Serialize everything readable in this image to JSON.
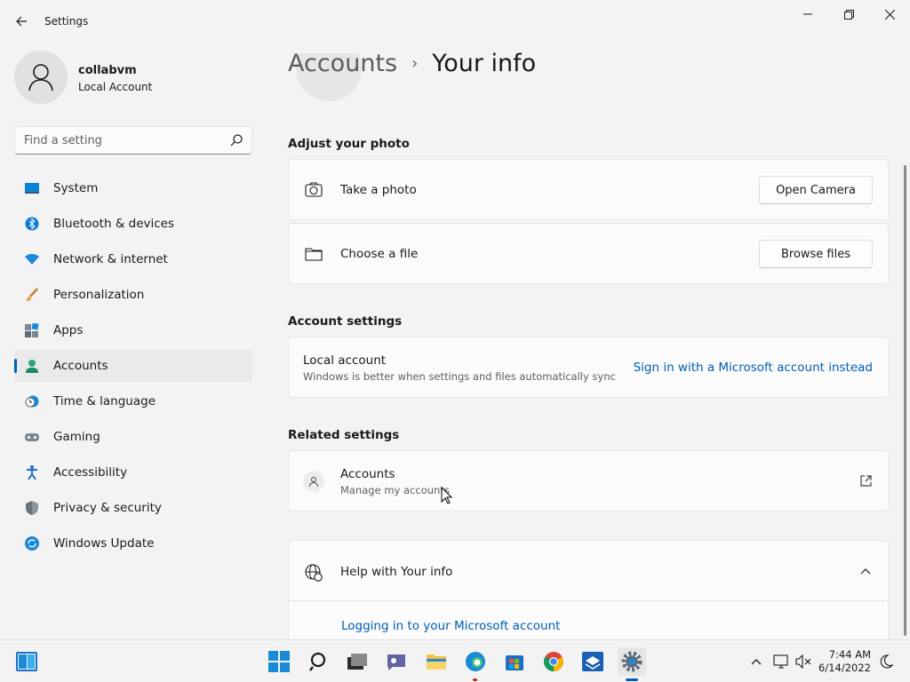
{
  "window": {
    "title": "Settings"
  },
  "user": {
    "name": "collabvm",
    "account_type": "Local Account"
  },
  "search": {
    "placeholder": "Find a setting"
  },
  "nav": {
    "items": [
      {
        "label": "System",
        "icon": "system-icon"
      },
      {
        "label": "Bluetooth & devices",
        "icon": "bluetooth-icon"
      },
      {
        "label": "Network & internet",
        "icon": "wifi-icon"
      },
      {
        "label": "Personalization",
        "icon": "brush-icon"
      },
      {
        "label": "Apps",
        "icon": "apps-icon"
      },
      {
        "label": "Accounts",
        "icon": "accounts-icon",
        "active": true
      },
      {
        "label": "Time & language",
        "icon": "clock-globe-icon"
      },
      {
        "label": "Gaming",
        "icon": "gamepad-icon"
      },
      {
        "label": "Accessibility",
        "icon": "accessibility-icon"
      },
      {
        "label": "Privacy & security",
        "icon": "shield-icon"
      },
      {
        "label": "Windows Update",
        "icon": "update-icon"
      }
    ]
  },
  "breadcrumb": {
    "parent": "Accounts",
    "separator": "›",
    "current": "Your info"
  },
  "adjust_photo": {
    "title": "Adjust your photo",
    "take_photo": {
      "label": "Take a photo",
      "button": "Open Camera",
      "icon": "camera-icon"
    },
    "choose_file": {
      "label": "Choose a file",
      "button": "Browse files",
      "icon": "folder-icon"
    }
  },
  "account_settings": {
    "title": "Account settings",
    "local": {
      "label": "Local account",
      "description": "Windows is better when settings and files automatically sync",
      "link": "Sign in with a Microsoft account instead"
    }
  },
  "related": {
    "title": "Related settings",
    "accounts": {
      "label": "Accounts",
      "description": "Manage my accounts",
      "icon": "person-icon"
    }
  },
  "help": {
    "title": "Help with Your info",
    "link": "Logging in to your Microsoft account",
    "icon": "help-globe-icon"
  },
  "taskbar": {
    "time": "7:44 AM",
    "date": "6/14/2022",
    "apps": [
      "start-icon",
      "search-icon",
      "task-view-icon",
      "chat-icon",
      "file-explorer-icon",
      "edge-icon",
      "store-icon",
      "chrome-icon",
      "app-icon",
      "settings-icon"
    ]
  },
  "colors": {
    "accent": "#005fb8",
    "background": "#f3f3f3",
    "card": "#fbfbfb"
  }
}
